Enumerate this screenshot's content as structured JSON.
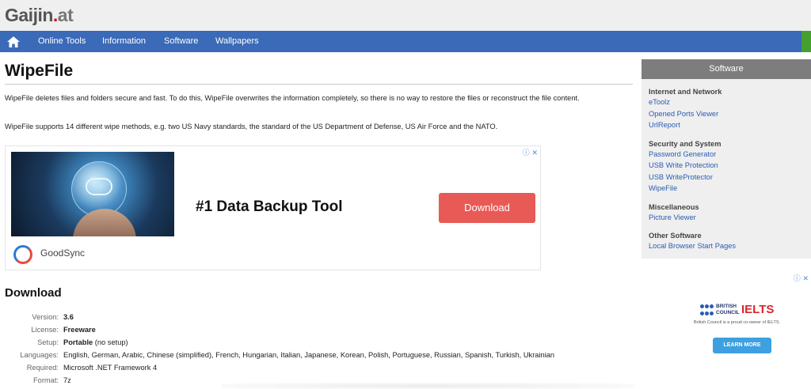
{
  "site": {
    "logo_main": "Gaijin",
    "logo_dot": ".",
    "logo_tld": "at"
  },
  "nav": {
    "home_icon": "home-icon",
    "items": [
      {
        "label": "Online Tools"
      },
      {
        "label": "Information"
      },
      {
        "label": "Software"
      },
      {
        "label": "Wallpapers"
      }
    ]
  },
  "page": {
    "title": "WipeFile",
    "paragraphs": [
      "WipeFile deletes files and folders secure and fast. To do this, WipeFile overwrites the information completely, so there is no way to restore the files or reconstruct the file content.",
      "WipeFile supports 14 different wipe methods, e.g. two US Navy standards, the standard of the US Department of Defense, US Air Force and the NATO."
    ]
  },
  "ad": {
    "headline": "#1 Data Backup Tool",
    "button": "Download",
    "brand": "GoodSync",
    "choice": "ⓘ ✕"
  },
  "download": {
    "title": "Download",
    "rows": [
      {
        "key": "Version:",
        "value": "3.6"
      },
      {
        "key": "License:",
        "value": "Freeware"
      },
      {
        "key": "Setup:",
        "value": "Portable",
        "extra": " (no setup)"
      },
      {
        "key": "Languages:",
        "value": "English, German, Arabic, Chinese (simplified), French, Hungarian, Italian, Japanese, Korean, Polish, Portuguese, Russian, Spanish, Turkish, Ukrainian"
      },
      {
        "key": "Required:",
        "value": "Microsoft .NET Framework 4"
      },
      {
        "key": "Format:",
        "value": "7z"
      }
    ]
  },
  "sidebar": {
    "header": "Software",
    "sections": [
      {
        "title": "Internet and Network",
        "links": [
          "eToolz",
          "Opened Ports Viewer",
          "UrlReport"
        ]
      },
      {
        "title": "Security and System",
        "links": [
          "Password Generator",
          "USB Write Protection",
          "USB WriteProtector",
          "WipeFile"
        ]
      },
      {
        "title": "Miscellaneous",
        "links": [
          "Picture Viewer"
        ]
      },
      {
        "title": "Other Software",
        "links": [
          "Local Browser Start Pages"
        ]
      }
    ]
  },
  "ad2": {
    "choice": "ⓘ ✕",
    "bc_line1": "BRITISH",
    "bc_line2": "COUNCIL",
    "ielts": "IELTS",
    "sub": "British Council is a proud co-owner of IELTS.",
    "button": "LEARN MORE"
  },
  "colors": {
    "nav": "#3a6ab8",
    "accent_green": "#46a02f",
    "ad_button": "#e85a55",
    "link": "#2a5db0"
  }
}
